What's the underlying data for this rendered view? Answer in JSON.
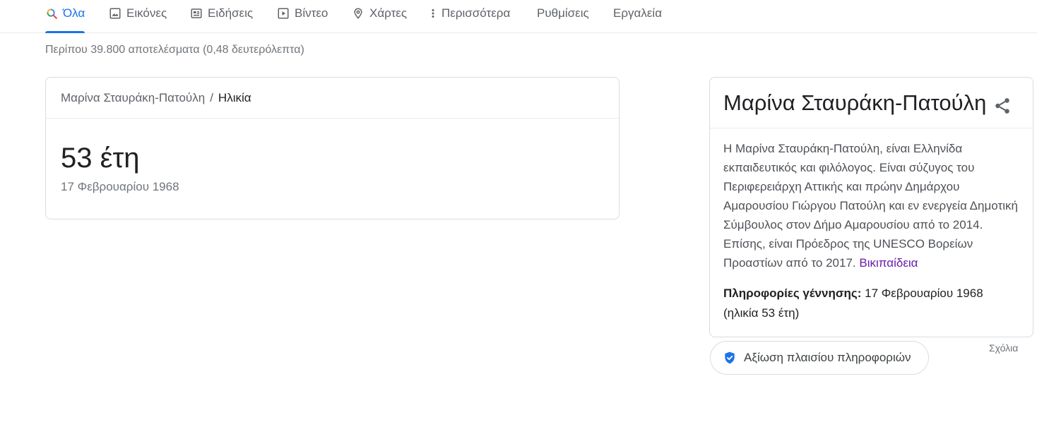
{
  "tabs": [
    {
      "label": "Όλα",
      "icon": "search-icon",
      "active": true
    },
    {
      "label": "Εικόνες",
      "icon": "image-icon"
    },
    {
      "label": "Ειδήσεις",
      "icon": "news-icon"
    },
    {
      "label": "Βίντεο",
      "icon": "play-icon"
    },
    {
      "label": "Χάρτες",
      "icon": "map-pin-icon"
    },
    {
      "label": "Περισσότερα",
      "icon": "more-vert-icon"
    },
    {
      "label": "Ρυθμίσεις"
    },
    {
      "label": "Εργαλεία"
    }
  ],
  "results_stats": "Περίπου 39.800 αποτελέσματα (0,48 δευτερόλεπτα)",
  "age_card": {
    "breadcrumb_person": "Μαρίνα Σταυράκη-Πατούλη",
    "breadcrumb_separator": "/",
    "breadcrumb_current": "Ηλικία",
    "value": "53 έτη",
    "birth_date": "17 Φεβρουαρίου 1968"
  },
  "knowledge_panel": {
    "title": "Μαρίνα Σταυράκη-Πατούλη",
    "share_icon": "share-icon",
    "description": "Η Μαρίνα Σταυράκη-Πατούλη, είναι Ελληνίδα εκπαιδευτικός και φιλόλογος. Είναι σύζυγος του Περιφερειάρχη Αττικής και πρώην Δημάρχου Αμαρουσίου Γιώργου Πατούλη και εν ενεργεία Δημοτική Σύμβουλος στον Δήμο Αμαρουσίου από το 2014. Επίσης, είναι Πρόεδρος της UNESCO Βορείων Προαστίων από το 2017.",
    "source_link": "Βικιπαίδεια",
    "birth_label": "Πληροφορίες γέννησης:",
    "birth_value": "17 Φεβρουαρίου 1968 (ηλικία 53 έτη)"
  },
  "feedback_label": "Σχόλια",
  "rate_button": {
    "label": "Αξίωση πλαισίου πληροφοριών",
    "icon": "verified-shield-icon"
  },
  "colors": {
    "accent": "#1a73e8",
    "link_visited": "#681da8",
    "muted_text": "#70757a"
  }
}
